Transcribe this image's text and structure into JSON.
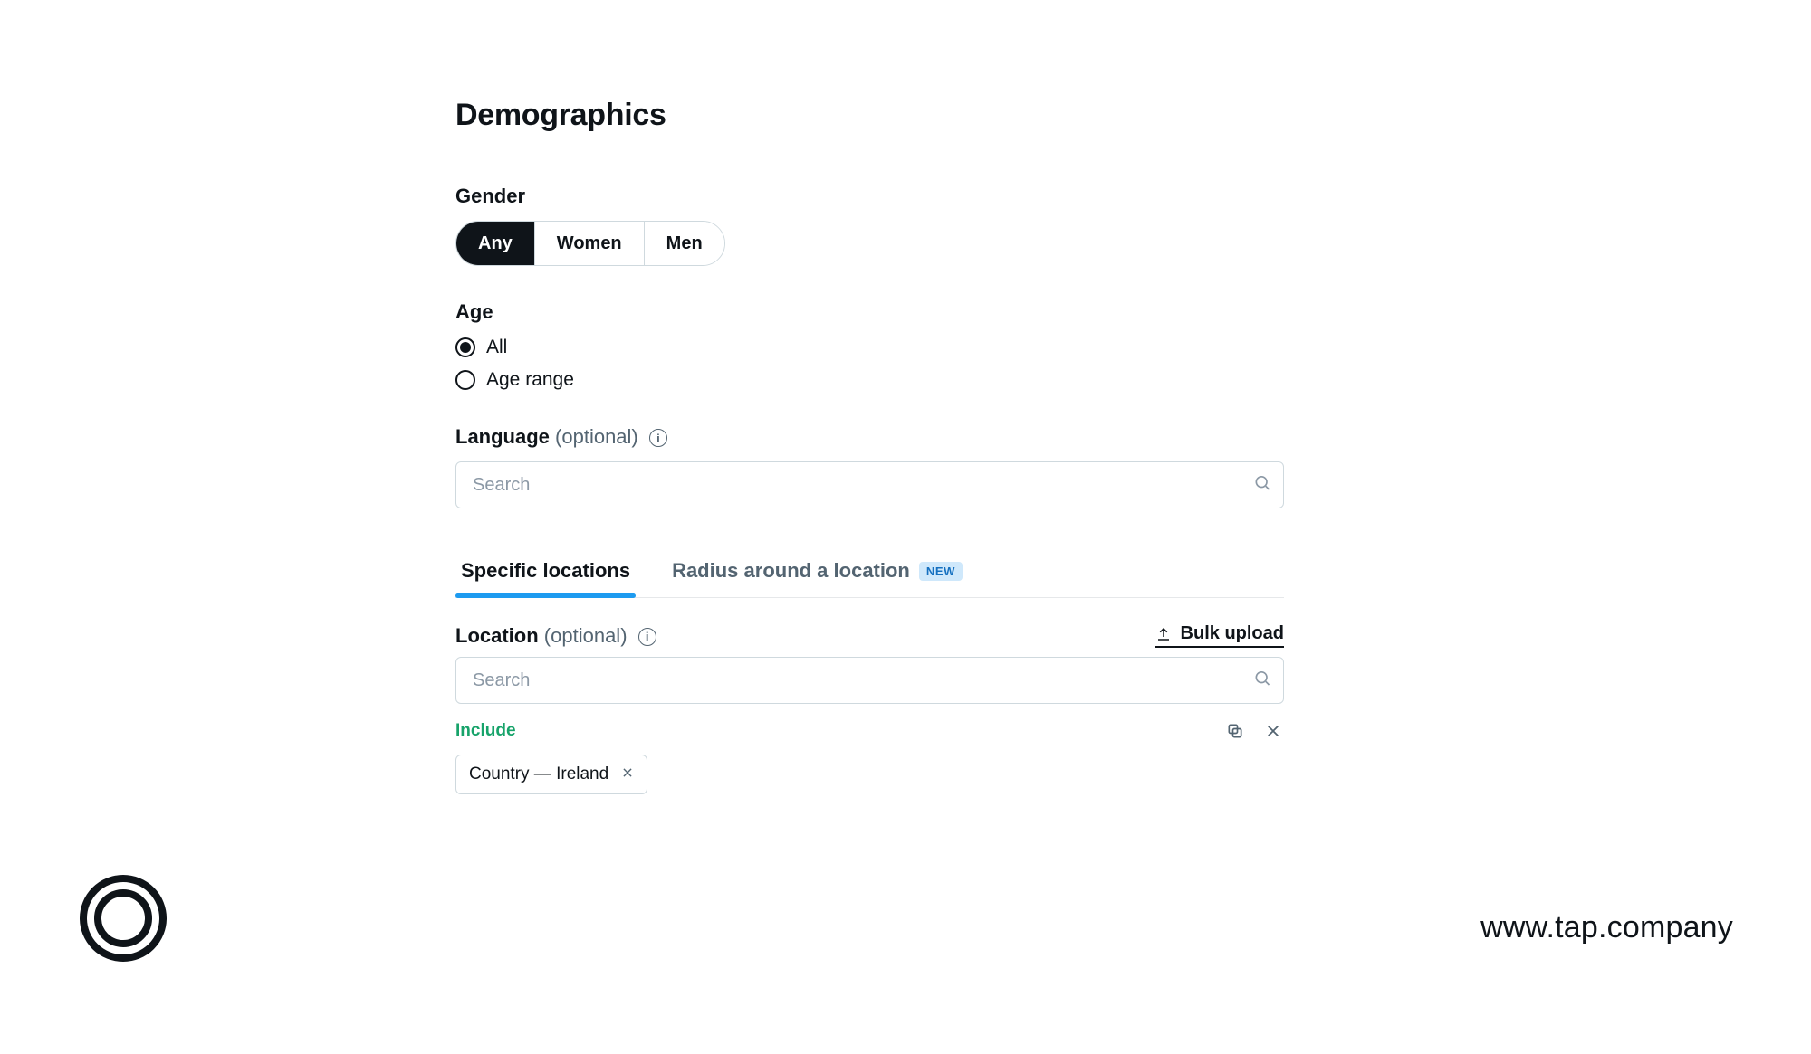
{
  "title": "Demographics",
  "gender": {
    "label": "Gender",
    "options": [
      "Any",
      "Women",
      "Men"
    ],
    "selected_index": 0
  },
  "age": {
    "label": "Age",
    "options": [
      "All",
      "Age range"
    ],
    "selected_index": 0
  },
  "language": {
    "label": "Language",
    "optional": "(optional)",
    "placeholder": "Search"
  },
  "tabs": {
    "items": [
      {
        "label": "Specific locations"
      },
      {
        "label": "Radius around a location",
        "badge": "NEW"
      }
    ],
    "active_index": 0
  },
  "location": {
    "label": "Location",
    "optional": "(optional)",
    "placeholder": "Search",
    "bulk_upload": "Bulk upload",
    "include_label": "Include",
    "chip_text": "Country — Ireland"
  },
  "footer": {
    "url": "www.tap.company"
  }
}
